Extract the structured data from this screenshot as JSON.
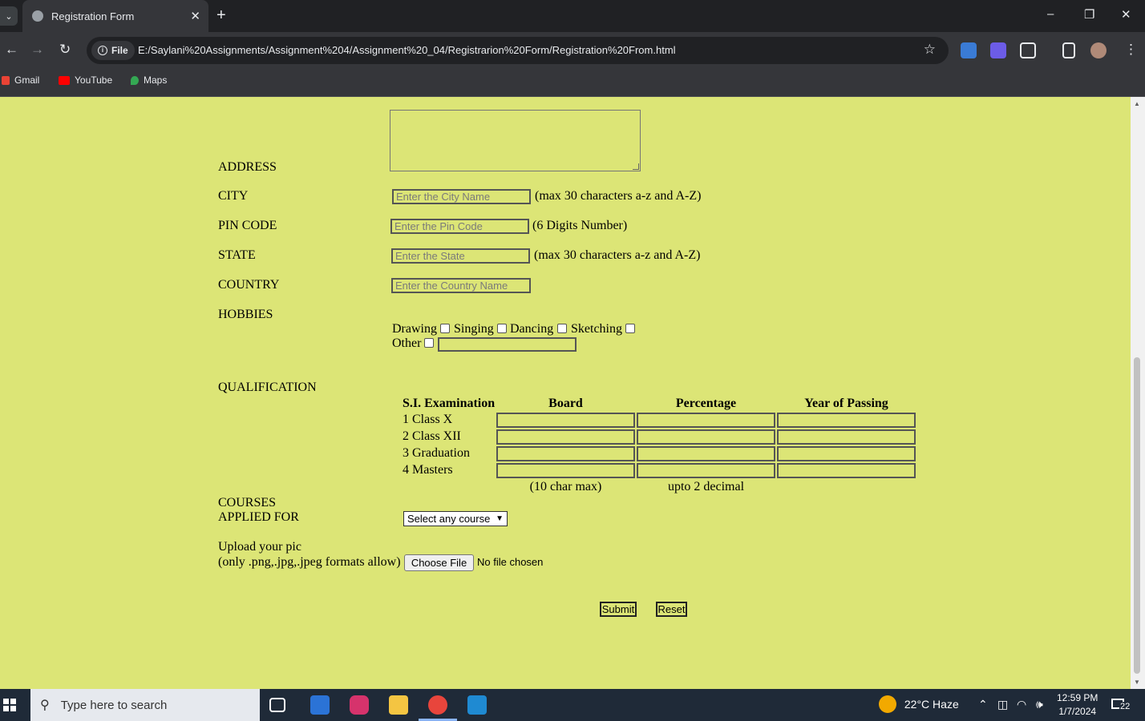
{
  "browser": {
    "tab_title": "Registration Form",
    "new_tab": "+",
    "site_chip": "File",
    "url": "E:/Saylani%20Assignments/Assignment%204/Assignment%20_04/Registrarion%20Form/Registration%20From.html",
    "bookmarks": [
      "Gmail",
      "YouTube",
      "Maps"
    ],
    "window_controls": [
      "–",
      "❐",
      "✕"
    ]
  },
  "form": {
    "address_label": "ADDRESS",
    "city_label": "CITY",
    "city_placeholder": "Enter the City Name",
    "city_hint": "(max 30 characters a-z and A-Z)",
    "pin_label": "PIN CODE",
    "pin_placeholder": "Enter the Pin Code",
    "pin_hint": "(6 Digits Number)",
    "state_label": "STATE",
    "state_placeholder": "Enter the State",
    "state_hint": "(max 30 characters a-z and A-Z)",
    "country_label": "COUNTRY",
    "country_placeholder": "Enter the Country Name",
    "hobbies_label": "HOBBIES",
    "hobbies": [
      "Drawing",
      "Singing",
      "Dancing",
      "Sketching"
    ],
    "hobby_other": "Other",
    "qualification_label": "QUALIFICATION",
    "qualification_headers": [
      "S.I. Examination",
      "Board",
      "Percentage",
      "Year of Passing"
    ],
    "qualification_rows": [
      "1 Class X",
      "2 Class XII",
      "3 Graduation",
      "4 Masters"
    ],
    "board_note": "(10 char max)",
    "percentage_note": "upto 2 decimal",
    "courses_label_1": "COURSES",
    "courses_label_2": "APPLIED FOR",
    "course_select": "Select any course",
    "upload_label_1": "Upload your pic",
    "upload_label_2": "(only .png,.jpg,.jpeg formats allow)",
    "choose_file": "Choose File",
    "no_file": "No file chosen",
    "submit": "Submit",
    "reset": "Reset"
  },
  "taskbar": {
    "search_placeholder": "Type here to search",
    "weather": "22°C  Haze",
    "time": "12:59 PM",
    "date": "1/7/2024",
    "notifications": "22"
  }
}
